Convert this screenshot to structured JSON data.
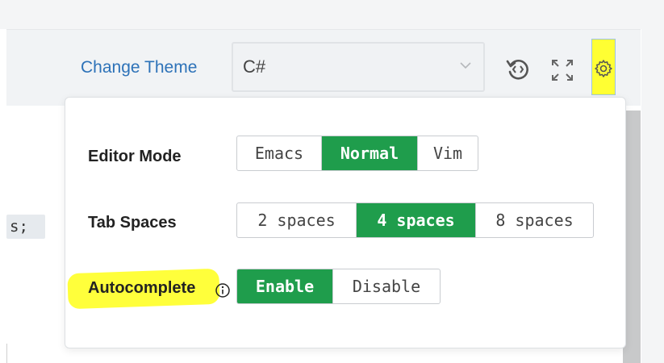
{
  "header": {
    "change_theme_label": "Change Theme",
    "language": {
      "selected": "C#"
    }
  },
  "toolbar_icons": [
    "reset-code-icon",
    "fullscreen-icon",
    "settings-gear-icon"
  ],
  "editor": {
    "code_fragment": "s;"
  },
  "settings": {
    "editor_mode": {
      "label": "Editor Mode",
      "options": [
        "Emacs",
        "Normal",
        "Vim"
      ],
      "selected": "Normal"
    },
    "tab_spaces": {
      "label": "Tab Spaces",
      "options": [
        "2 spaces",
        "4 spaces",
        "8 spaces"
      ],
      "selected": "4 spaces"
    },
    "autocomplete": {
      "label": "Autocomplete",
      "options": [
        "Enable",
        "Disable"
      ],
      "selected": "Enable"
    }
  },
  "colors": {
    "accent_green": "#1f9d4c",
    "link_blue": "#2d72b8",
    "highlight_yellow": "#ffff33"
  }
}
